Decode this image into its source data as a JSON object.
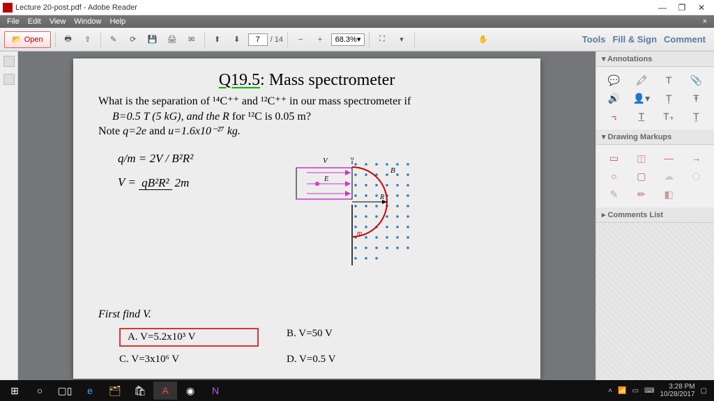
{
  "window": {
    "title": "Lecture 20-post.pdf - Adobe Reader"
  },
  "menu": {
    "file": "File",
    "edit": "Edit",
    "view": "View",
    "window": "Window",
    "help": "Help"
  },
  "toolbar": {
    "open": "Open",
    "page_current": "7",
    "page_total": "/ 14",
    "zoom": "68.3%",
    "tools": "Tools",
    "fillsign": "Fill & Sign",
    "comment": "Comment"
  },
  "rightpanel": {
    "annotations": "Annotations",
    "drawing": "Drawing Markups",
    "comments": "Comments List"
  },
  "doc": {
    "qnum": "Q19.5",
    "title_rest": ": Mass spectrometer",
    "line1a": "What is the separation of ",
    "c14": "¹⁴C⁺⁺",
    "line1b": " and ",
    "c12": "¹²C⁺⁺",
    "line1c": " in our mass spectrometer if",
    "line2a": "B=0.5 T (5 kG), and the ",
    "line2b": " for ¹²C is 0.05 m?",
    "line3a": "Note ",
    "line3b": "q=2e",
    "line3c": " and ",
    "line3d": "u=1.6x10⁻²⁷ kg.",
    "formula1_lhs": "q/m = 2V / B²R²",
    "formula2_lhs": "V = ",
    "formula2_num": "qB²R²",
    "formula2_den": "2m",
    "first": "First find V.",
    "ansA": "A. V=5.2x10³ V",
    "ansB": "B. V=50 V",
    "ansC": "C. V=3x10⁶ V",
    "ansD": "D. V=0.5 V"
  },
  "taskbar": {
    "time": "3:28 PM",
    "date": "10/28/2017"
  }
}
